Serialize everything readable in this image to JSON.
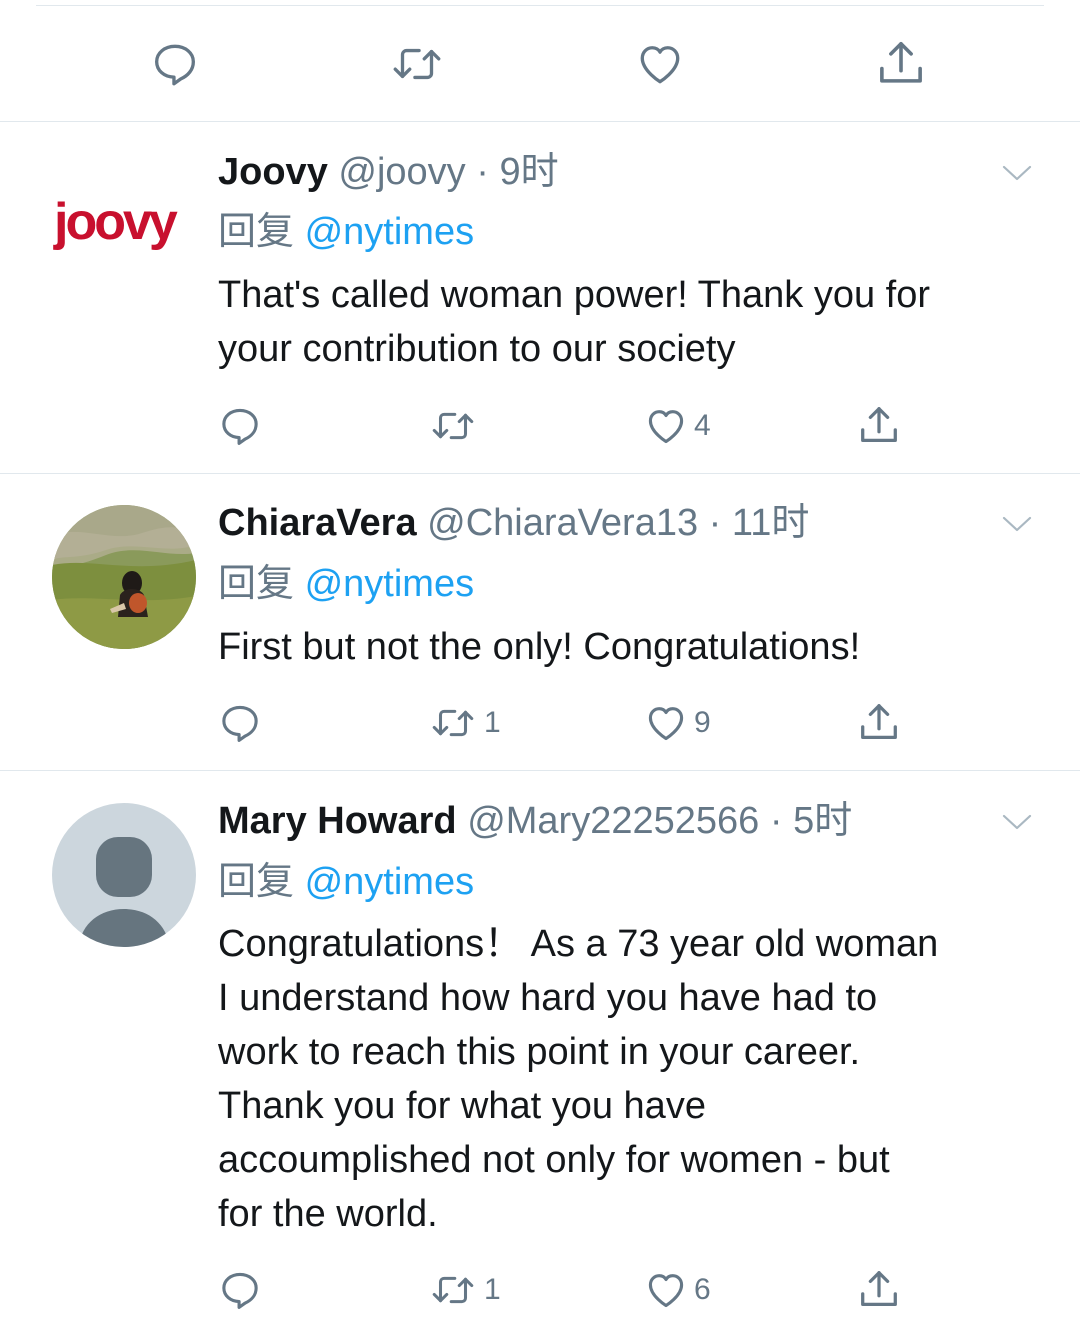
{
  "top_actions": {
    "reply_count": "",
    "retweet_count": "",
    "like_count": ""
  },
  "tweets": [
    {
      "name": "Joovy",
      "handle": "@joovy",
      "dot": "·",
      "time": "9时",
      "reply_prefix": "回复",
      "reply_to": "@nytimes",
      "text": [
        "That's called woman power!  Thank you for",
        "your contribution to our society"
      ],
      "avatar_text": "joovy",
      "reply_count": "",
      "retweet_count": "",
      "like_count": "4"
    },
    {
      "name": "ChiaraVera",
      "handle": "@ChiaraVera13",
      "dot": "·",
      "time": "11时",
      "reply_prefix": "回复",
      "reply_to": "@nytimes",
      "text": [
        "First but not the only! Congratulations!"
      ],
      "reply_count": "",
      "retweet_count": "1",
      "like_count": "9"
    },
    {
      "name": "Mary Howard",
      "handle": "@Mary22252566",
      "dot": "·",
      "time": "5时",
      "reply_prefix": "回复",
      "reply_to": "@nytimes",
      "text": [
        "Congratulations！ As a 73 year old woman",
        "I understand how hard you have had to",
        "work to reach this point in your career.",
        "Thank you for what you have",
        "accoumplished not only for women - but",
        "for the world."
      ],
      "reply_count": "",
      "retweet_count": "1",
      "like_count": "6"
    }
  ],
  "colors": {
    "accent": "#1da1f2",
    "muted": "#657786",
    "text": "#14171a",
    "divider": "#e1e8ed",
    "brand_joovy": "#c8102e"
  },
  "icons": [
    "reply-icon",
    "retweet-icon",
    "like-icon",
    "share-icon",
    "chevron-down-icon"
  ]
}
